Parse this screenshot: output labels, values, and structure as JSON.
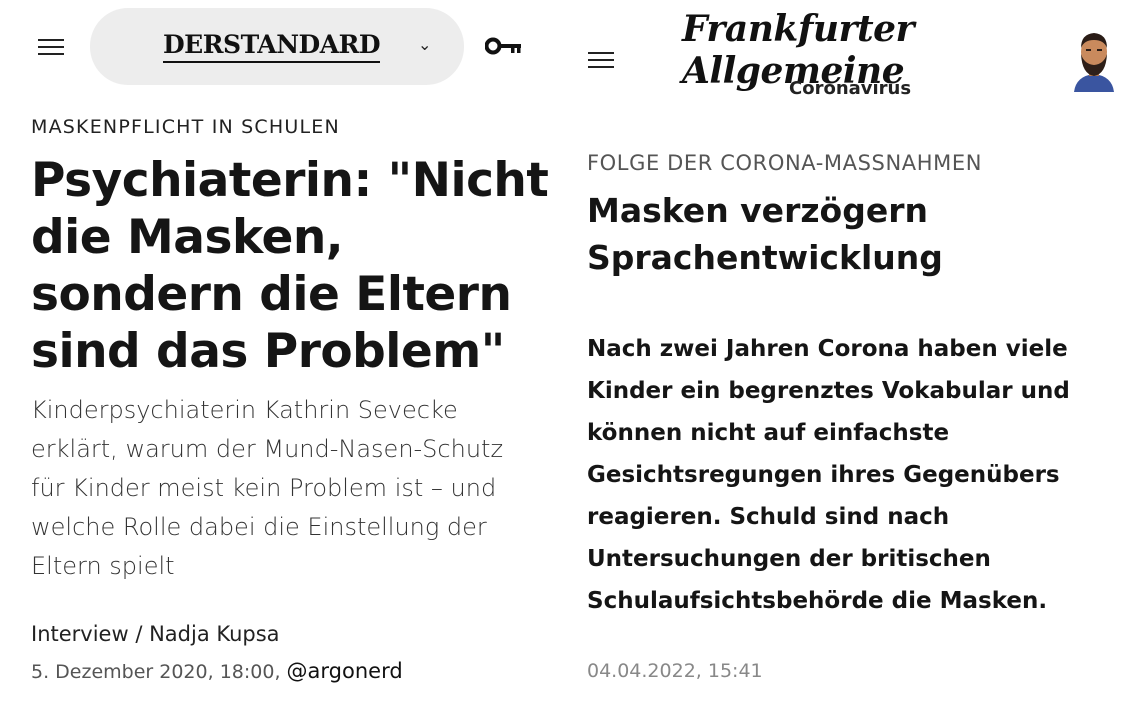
{
  "left": {
    "brand": "DERSTANDARD",
    "kicker": "MASKENPFLICHT IN SCHULEN",
    "headline": "Psychiaterin: \"Nicht die Masken, sondern die Eltern sind das Problem\"",
    "teaser": "Kinderpsychiaterin Kathrin Sevecke erklärt, warum der Mund-Nasen-Schutz für Kinder meist kein Problem ist – und welche Rolle dabei die Einstellung der Eltern spielt",
    "author": "Interview / Nadja Kupsa",
    "date": "5. Dezember 2020, 18:00,",
    "handle": "@argonerd",
    "icons": {
      "menu": "hamburger-menu-icon",
      "dropdown": "chevron-down-icon",
      "login": "key-icon"
    }
  },
  "right": {
    "brand": "Frankfurter Allgemeine",
    "section": "Coronavirus",
    "kicker": "FOLGE DER CORONA-MASSNAHMEN",
    "headline": "Masken verzögern Sprachentwicklung",
    "teaser": "Nach zwei Jahren Corona haben viele Kinder ein begrenztes Vokabular und können nicht auf einfachste Gesichtsregungen ihres Gegenübers reagieren. Schuld sind nach Untersuchungen der britischen Schulaufsichtsbehörde die Masken.",
    "date": "04.04.2022, 15:41",
    "icons": {
      "menu": "hamburger-menu-icon",
      "profile": "avatar-icon"
    }
  }
}
